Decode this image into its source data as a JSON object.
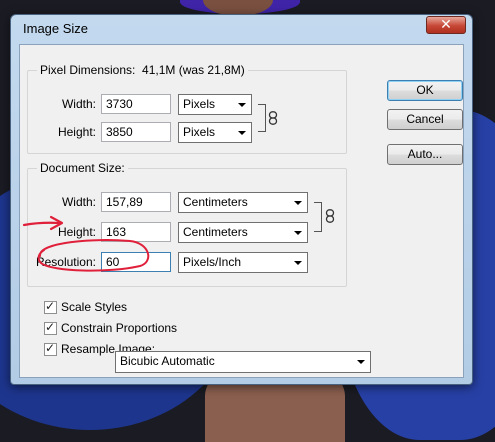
{
  "window": {
    "title": "Image Size",
    "close_glyph": "✕"
  },
  "pixel_dimensions": {
    "legend": "Pixel Dimensions:",
    "size_text": "41,1M (was 21,8M)",
    "width_label": "Width:",
    "width_value": "3730",
    "width_unit": "Pixels",
    "height_label": "Height:",
    "height_value": "3850",
    "height_unit": "Pixels"
  },
  "document_size": {
    "legend": "Document Size:",
    "width_label": "Width:",
    "width_value": "157,89",
    "width_unit": "Centimeters",
    "height_label": "Height:",
    "height_value": "163",
    "height_unit": "Centimeters",
    "resolution_label": "Resolution:",
    "resolution_value": "60",
    "resolution_unit": "Pixels/Inch"
  },
  "options": {
    "scale_styles": {
      "label": "Scale Styles",
      "checked": true
    },
    "constrain_proportions": {
      "label": "Constrain Proportions",
      "checked": true
    },
    "resample_image": {
      "label": "Resample Image:",
      "checked": true
    },
    "resample_method": "Bicubic Automatic"
  },
  "buttons": {
    "ok": "OK",
    "cancel": "Cancel",
    "auto": "Auto..."
  },
  "icons": {
    "link": "chain-link-icon",
    "checkmark": "✓"
  },
  "annotations": {
    "color": "#e0203a"
  }
}
